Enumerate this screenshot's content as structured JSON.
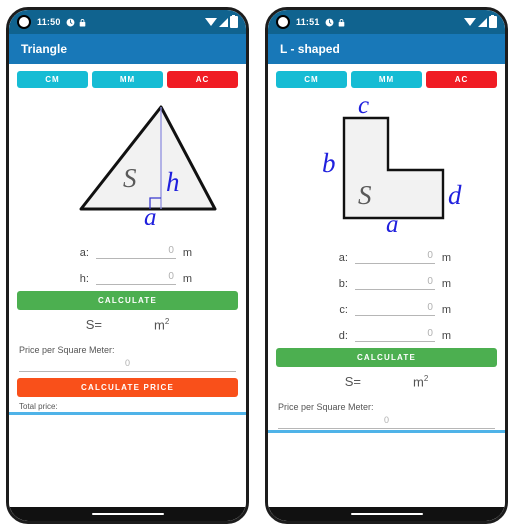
{
  "colors": {
    "statusbar": "#10638f",
    "appbar": "#1878b8",
    "unit_button": "#16bcd4",
    "clear_button": "#f01c24",
    "calculate_button": "#4caf50",
    "price_button": "#f9501a",
    "scroll_accent": "#4fb3e8",
    "shape_fill": "#f2f2f2",
    "shape_stroke": "#111111",
    "label_blue": "#2020dd",
    "area_label_gray": "#555555"
  },
  "phones": [
    {
      "status": {
        "time": "11:50",
        "icons": [
          "camera-punch-hole",
          "alarm-icon",
          "lock-icon",
          "wifi-icon",
          "signal-icon",
          "battery-icon"
        ]
      },
      "appbar": {
        "title": "Triangle"
      },
      "unit_buttons": [
        {
          "label": "CM",
          "style": "cyan"
        },
        {
          "label": "MM",
          "style": "cyan"
        },
        {
          "label": "AC",
          "style": "red"
        }
      ],
      "diagram": {
        "type": "triangle",
        "area_label": "S",
        "edge_labels": {
          "base": "a",
          "height": "h"
        }
      },
      "fields": [
        {
          "label": "a:",
          "value": "",
          "placeholder": "0",
          "unit": "m"
        },
        {
          "label": "h:",
          "value": "",
          "placeholder": "0",
          "unit": "m"
        }
      ],
      "calculate_label": "CALCULATE",
      "result": {
        "label": "S=",
        "value": "",
        "unit": "m",
        "unit_exponent": "2"
      },
      "price": {
        "label": "Price per Square Meter:",
        "value": "",
        "placeholder": "0",
        "button_label": "CALCULATE PRICE",
        "total_label": "Total price:"
      }
    },
    {
      "status": {
        "time": "11:51",
        "icons": [
          "camera-punch-hole",
          "alarm-icon",
          "lock-icon",
          "wifi-icon",
          "signal-icon",
          "battery-icon"
        ]
      },
      "appbar": {
        "title": "L - shaped"
      },
      "unit_buttons": [
        {
          "label": "CM",
          "style": "cyan"
        },
        {
          "label": "MM",
          "style": "cyan"
        },
        {
          "label": "AC",
          "style": "red"
        }
      ],
      "diagram": {
        "type": "l-shape",
        "area_label": "S",
        "edge_labels": {
          "bottom": "a",
          "left": "b",
          "top": "c",
          "right": "d"
        }
      },
      "fields": [
        {
          "label": "a:",
          "value": "",
          "placeholder": "0",
          "unit": "m"
        },
        {
          "label": "b:",
          "value": "",
          "placeholder": "0",
          "unit": "m"
        },
        {
          "label": "c:",
          "value": "",
          "placeholder": "0",
          "unit": "m"
        },
        {
          "label": "d:",
          "value": "",
          "placeholder": "0",
          "unit": "m"
        }
      ],
      "calculate_label": "CALCULATE",
      "result": {
        "label": "S=",
        "value": "",
        "unit": "m",
        "unit_exponent": "2"
      },
      "price": {
        "label": "Price per Square Meter:",
        "value": "",
        "placeholder": "0",
        "button_label": "",
        "total_label": ""
      }
    }
  ]
}
